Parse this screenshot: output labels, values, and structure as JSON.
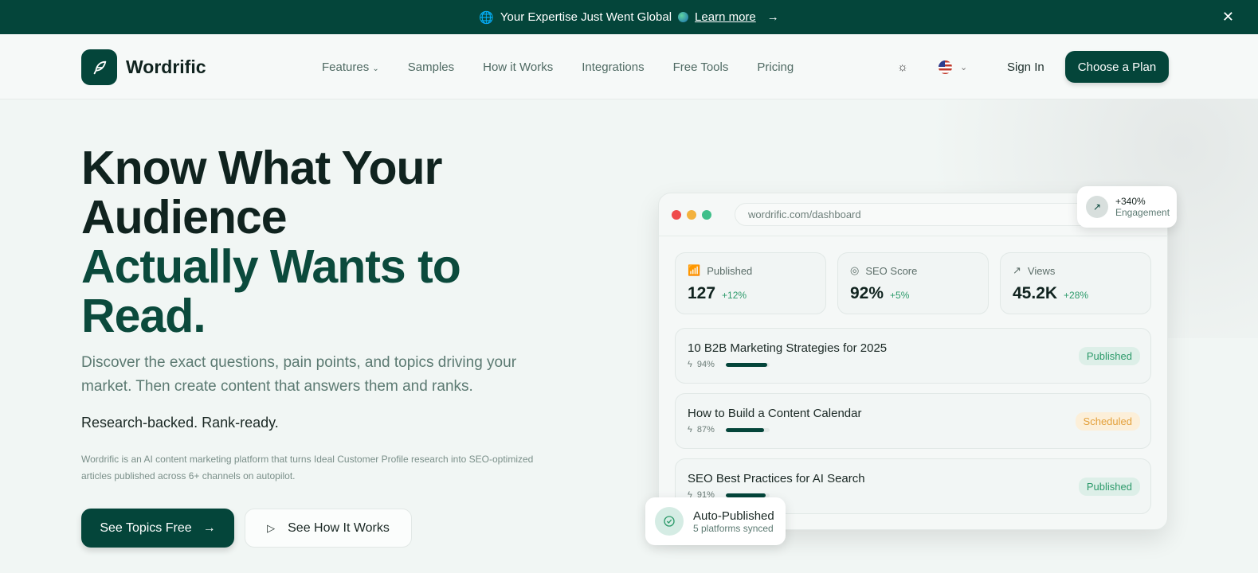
{
  "banner": {
    "text": "Your Expertise Just Went Global",
    "link": "Learn more"
  },
  "nav": {
    "brand": "Wordrific",
    "items": [
      "Features",
      "Samples",
      "How it Works",
      "Integrations",
      "Free Tools",
      "Pricing"
    ],
    "sign_in": "Sign In",
    "cta": "Choose a Plan"
  },
  "hero": {
    "line1": "Know What Your",
    "line2": "Audience",
    "line3": "Actually Wants to",
    "line4": "Read.",
    "subtitle": "Discover the exact questions, pain points, and topics driving your market. Then create content that answers them and ranks.",
    "tagline": "Research-backed. Rank-ready.",
    "description": "Wordrific is an AI content marketing platform that turns Ideal Customer Profile research into SEO-optimized articles published across 6+ channels on autopilot.",
    "primary_button": "See Topics Free",
    "secondary_button": "See How It Works"
  },
  "dashboard": {
    "url": "wordrific.com/dashboard",
    "stats": [
      {
        "label": "Published",
        "value": "127",
        "change": "+12%"
      },
      {
        "label": "SEO Score",
        "value": "92%",
        "change": "+5%"
      },
      {
        "label": "Views",
        "value": "45.2K",
        "change": "+28%"
      }
    ],
    "articles": [
      {
        "title": "10 B2B Marketing Strategies for 2025",
        "score": "94%",
        "progress": 94,
        "status": "Published"
      },
      {
        "title": "How to Build a Content Calendar",
        "score": "87%",
        "progress": 87,
        "status": "Scheduled"
      },
      {
        "title": "SEO Best Practices for AI Search",
        "score": "91%",
        "progress": 91,
        "status": "Published"
      }
    ]
  },
  "engagement": {
    "value": "+340%",
    "label": "Engagement"
  },
  "auto": {
    "title": "Auto-Published",
    "sub": "5 platforms synced"
  },
  "colors": {
    "brand": "#04453a",
    "positive": "#2c9a6a",
    "scheduled": "#e3a03b"
  }
}
